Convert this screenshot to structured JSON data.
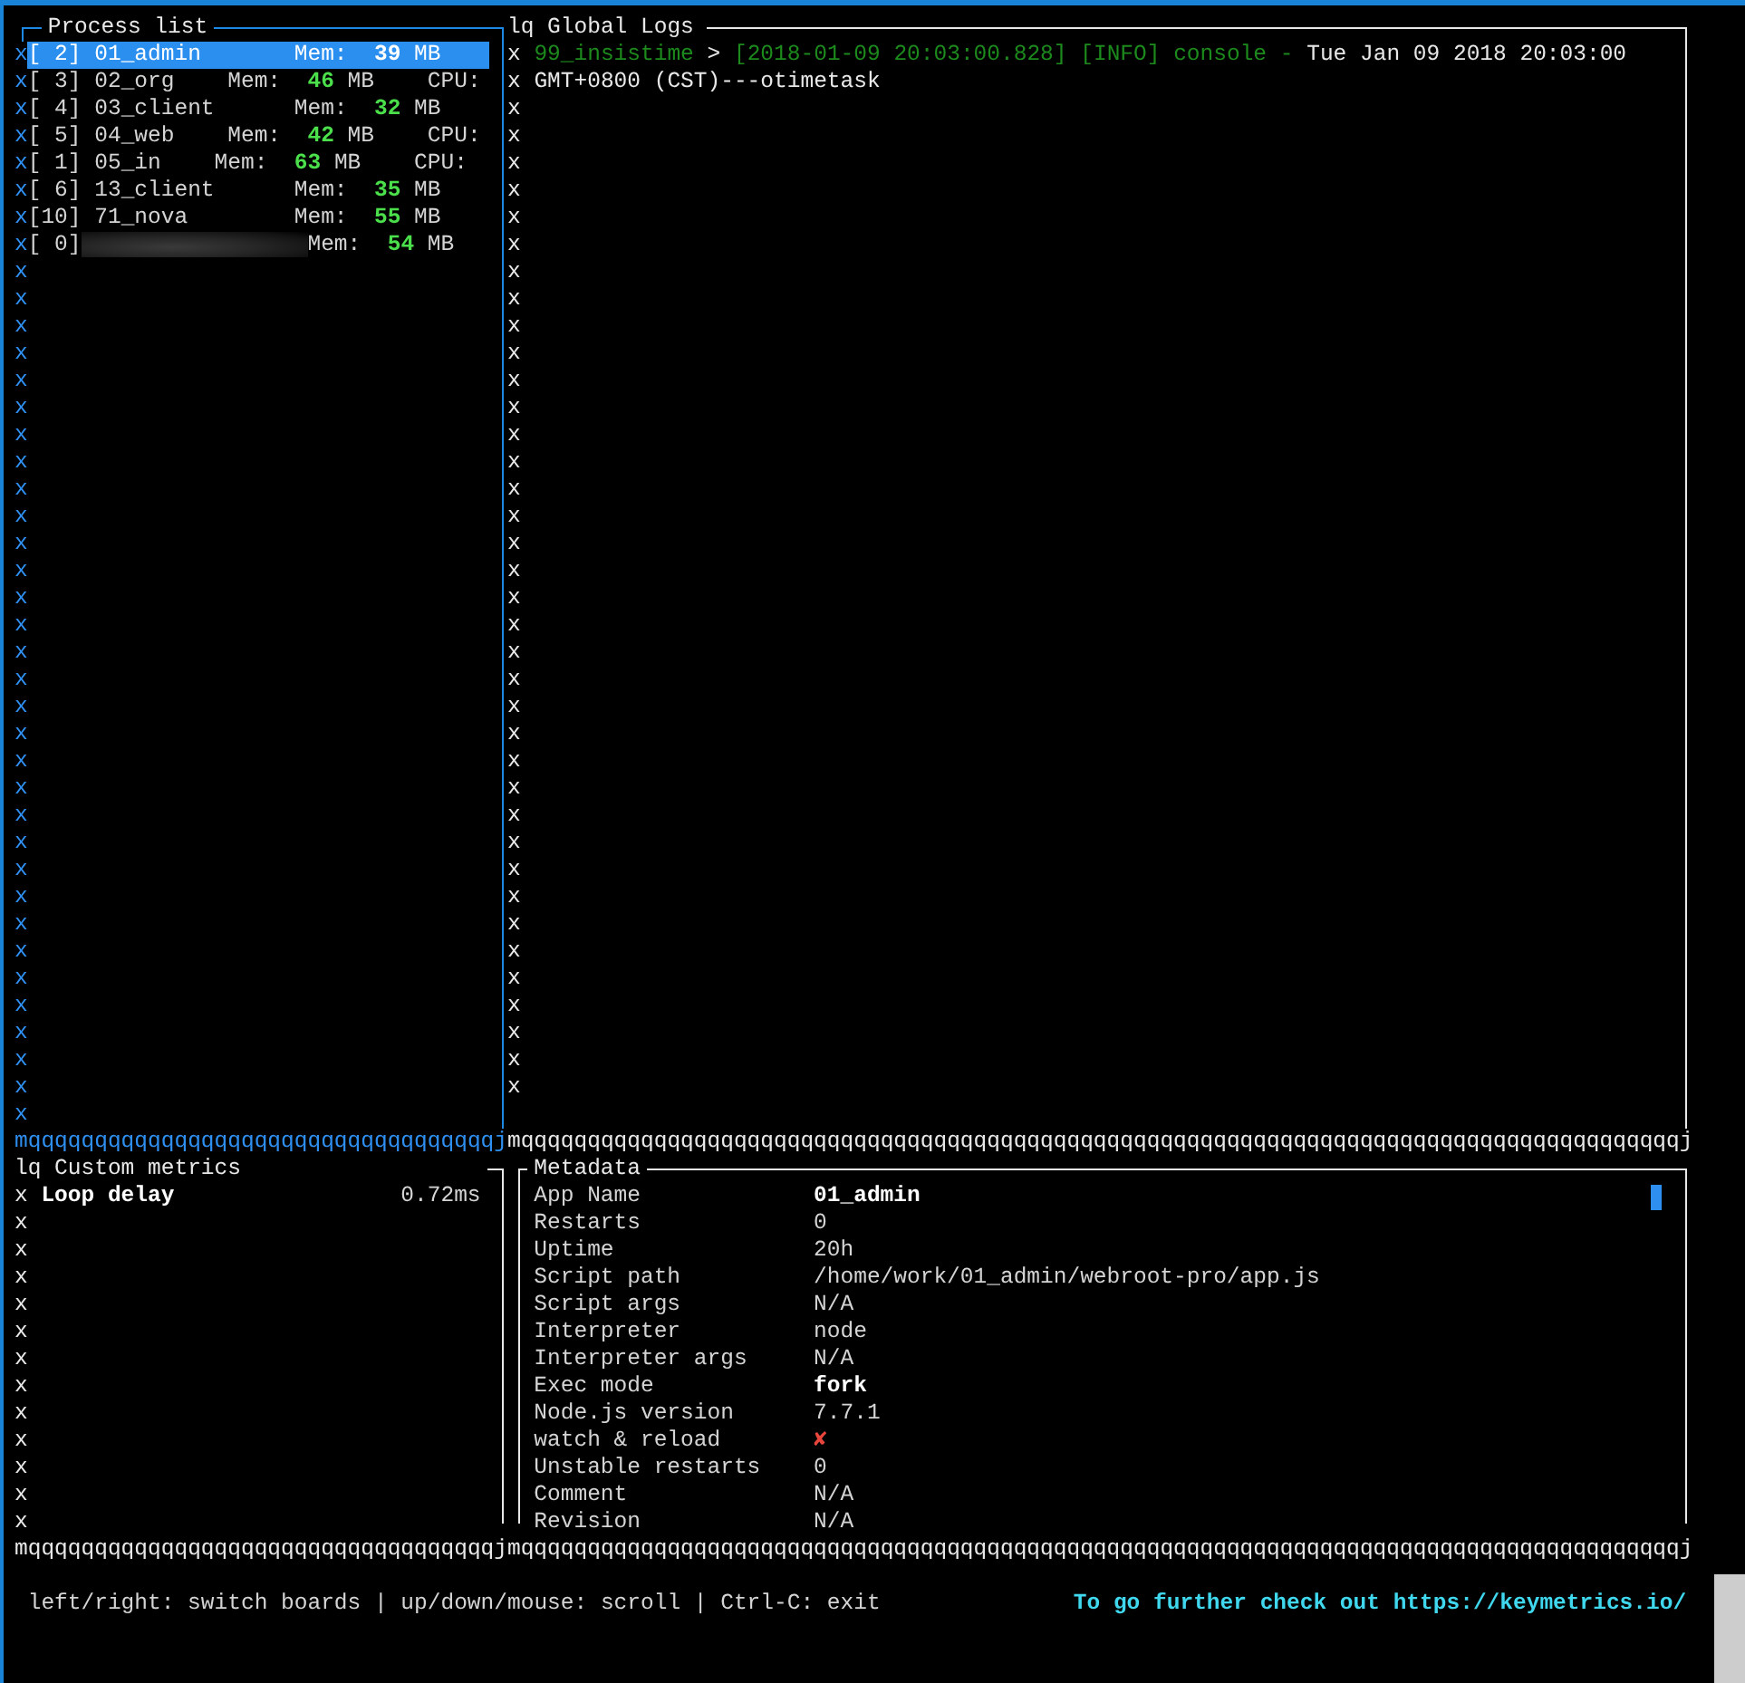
{
  "process_list": {
    "title": "Process list",
    "rows": [
      {
        "edge": "x",
        "selected": true,
        "kind": "plain",
        "label": "[ 2] 01_admin       Mem:",
        "mem": "39",
        "rest": "MB"
      },
      {
        "edge": "x",
        "selected": false,
        "kind": "plain",
        "label": "[ 3] 02_org    Mem:",
        "mem": "46",
        "rest": "MB    CPU:"
      },
      {
        "edge": "x",
        "selected": false,
        "kind": "plain",
        "label": "[ 4] 03_client      Mem:",
        "mem": "32",
        "rest": "MB"
      },
      {
        "edge": "x",
        "selected": false,
        "kind": "plain",
        "label": "[ 5] 04_web    Mem:",
        "mem": "42",
        "rest": "MB    CPU:"
      },
      {
        "edge": "x",
        "selected": false,
        "kind": "plain",
        "label": "[ 1] 05_in    Mem:",
        "mem": "63",
        "rest": "MB    CPU:"
      },
      {
        "edge": "x",
        "selected": false,
        "kind": "plain",
        "label": "[ 6] 13_client      Mem:",
        "mem": "35",
        "rest": "MB"
      },
      {
        "edge": "x",
        "selected": false,
        "kind": "plain",
        "label": "[10] 71_nova        Mem:",
        "mem": "55",
        "rest": "MB"
      },
      {
        "edge": "x",
        "selected": false,
        "kind": "redacted",
        "label": "[ 0]",
        "label2": "Mem:",
        "mem": "54",
        "rest": "MB"
      }
    ],
    "empty_lines": [
      "x",
      "x",
      "x",
      "x",
      "x",
      "x",
      "x",
      "x",
      "x",
      "x",
      "x",
      "x",
      "x",
      "x",
      "x",
      "x",
      "x",
      "x",
      "x",
      "x",
      "x",
      "x",
      "x",
      "x",
      "x",
      "x",
      "x",
      "x",
      "x",
      "x",
      "x",
      "x"
    ],
    "bottom_border": "mqqqqqqqqqqqqqqqqqqqqqqqqqqqqqqqqqqqj"
  },
  "global_logs": {
    "title": "lq Global Logs",
    "lines": [
      {
        "edge": "x",
        "segments": [
          {
            "kind": "source",
            "text": "99_insistime"
          },
          {
            "kind": "plain",
            "text": ">"
          },
          {
            "kind": "meta",
            "text": "[2018-01-09 20:03:00.828] [INFO] console -"
          },
          {
            "kind": "plain",
            "text": "Tue Jan 09 2018 20:03:00"
          }
        ]
      },
      {
        "edge": "x",
        "segments": [
          {
            "kind": "plain",
            "text": "GMT+0800 (CST)---otimetask"
          }
        ]
      }
    ],
    "empty_lines": [
      "x",
      "x",
      "x",
      "x",
      "x",
      "x",
      "x",
      "x",
      "x",
      "x",
      "x",
      "x",
      "x",
      "x",
      "x",
      "x",
      "x",
      "x",
      "x",
      "x",
      "x",
      "x",
      "x",
      "x",
      "x",
      "x",
      "x",
      "x",
      "x",
      "x",
      "x",
      "x",
      "x",
      "x",
      "x",
      "x",
      "x"
    ],
    "bottom_border": "mqqqqqqqqqqqqqqqqqqqqqqqqqqqqqqqqqqqqqqqqqqqqqqqqqqqqqqqqqqqqqqqqqqqqqqqqqqqqqqqqqqqqqqqj"
  },
  "custom_metrics": {
    "title": "lq Custom metrics",
    "metrics": [
      {
        "edge": "x",
        "name": "Loop delay",
        "value": "0.72ms"
      }
    ],
    "empty_lines": [
      "x",
      "x",
      "x",
      "x",
      "x",
      "x",
      "x",
      "x",
      "x",
      "x",
      "x",
      "x"
    ],
    "bottom_border": "mqqqqqqqqqqqqqqqqqqqqqqqqqqqqqqqqqqqj"
  },
  "metadata": {
    "title": "Metadata",
    "rows": [
      {
        "label": "App Name",
        "value": "01_admin",
        "kind": "bold"
      },
      {
        "label": "Restarts",
        "value": "0",
        "kind": "plain"
      },
      {
        "label": "Uptime",
        "value": "20h",
        "kind": "plain"
      },
      {
        "label": "Script path",
        "value": "/home/work/01_admin/webroot-pro/app.js",
        "kind": "plain"
      },
      {
        "label": "Script args",
        "value": "N/A",
        "kind": "plain"
      },
      {
        "label": "Interpreter",
        "value": "node",
        "kind": "plain"
      },
      {
        "label": "Interpreter args",
        "value": "N/A",
        "kind": "plain"
      },
      {
        "label": "Exec mode",
        "value": "fork",
        "kind": "bold"
      },
      {
        "label": "Node.js version",
        "value": "7.7.1",
        "kind": "plain"
      },
      {
        "label": "watch & reload",
        "value": "✘",
        "kind": "error"
      },
      {
        "label": "Unstable restarts",
        "value": "0",
        "kind": "plain"
      },
      {
        "label": "Comment",
        "value": "N/A",
        "kind": "plain"
      },
      {
        "label": "Revision",
        "value": "N/A",
        "kind": "plain"
      }
    ],
    "bottom_border": "mqqqqqqqqqqqqqqqqqqqqqqqqqqqqqqqqqqqqqqqqqqqqqqqqqqqqqqqqqqqqqqqqqqqqqqqqqqqqqqqqqqqqqqqj"
  },
  "status_bar": {
    "help": "left/right: switch boards | up/down/mouse: scroll | Ctrl-C: exit",
    "link": "To go further check out https://keymetrics.io/"
  }
}
